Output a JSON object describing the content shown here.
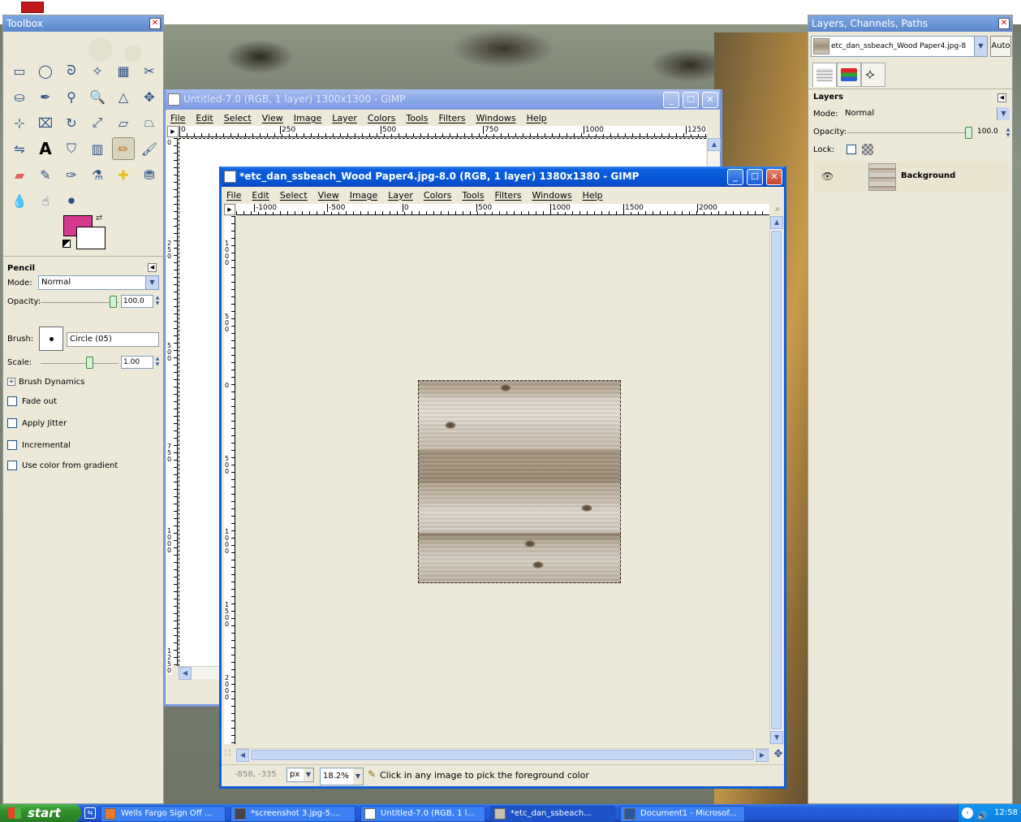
{
  "toolbox": {
    "title": "Toolbox",
    "tool_name": "Pencil",
    "mode_label": "Mode:",
    "mode_value": "Normal",
    "opacity_label": "Opacity:",
    "opacity_value": "100.0",
    "brush_label": "Brush:",
    "brush_value": "Circle (05)",
    "scale_label": "Scale:",
    "scale_value": "1.00",
    "brush_dynamics": "Brush Dynamics",
    "fade_out": "Fade out",
    "apply_jitter": "Apply Jitter",
    "incremental": "Incremental",
    "use_color_from_gradient": "Use color from gradient",
    "foreground_color": "#d63a90",
    "background_color": "#ffffff",
    "tools": [
      "rect-select-icon",
      "ellipse-select-icon",
      "free-select-icon",
      "fuzzy-select-icon",
      "select-by-color-icon",
      "scissors-icon",
      "foreground-select-icon",
      "paths-icon",
      "color-picker-icon",
      "zoom-icon",
      "measure-icon",
      "move-icon",
      "align-icon",
      "crop-icon",
      "rotate-icon",
      "scale-icon",
      "shear-icon",
      "perspective-icon",
      "flip-icon",
      "text-icon",
      "bucket-fill-icon",
      "blend-icon",
      "pencil-icon",
      "paintbrush-icon",
      "eraser-icon",
      "airbrush-icon",
      "ink-icon",
      "clone-icon",
      "heal-icon",
      "perspective-clone-icon",
      "blur-icon",
      "smudge-icon",
      "dodge-burn-icon"
    ]
  },
  "window_back": {
    "title": "Untitled-7.0 (RGB, 1 layer) 1300x1300 - GIMP",
    "ruler_labels": [
      "0",
      "250",
      "500",
      "750",
      "1000",
      "1250"
    ],
    "vruler_labels": [
      "0",
      "250",
      "500",
      "750",
      "1000",
      "1250"
    ]
  },
  "window_front": {
    "title": "*etc_dan_ssbeach_Wood Paper4.jpg-8.0 (RGB, 1 layer) 1380x1380 - GIMP",
    "ruler_labels": [
      "-1000",
      "-500",
      "0",
      "500",
      "1000",
      "1500",
      "2000"
    ],
    "vruler_labels": [
      "1000",
      "500",
      "0",
      "500",
      "1000",
      "1500",
      "2000"
    ],
    "coords": "-858, -335",
    "unit": "px",
    "zoom": "18.2%",
    "status": "Click in any image to pick the foreground color"
  },
  "menu": [
    "File",
    "Edit",
    "Select",
    "View",
    "Image",
    "Layer",
    "Colors",
    "Tools",
    "Filters",
    "Windows",
    "Help"
  ],
  "layers_dock": {
    "title": "Layers, Channels, Paths",
    "image_select": "etc_dan_ssbeach_Wood Paper4.jpg-8",
    "auto_button": "Auto",
    "section_title": "Layers",
    "mode_label": "Mode:",
    "mode_value": "Normal",
    "opacity_label": "Opacity:",
    "opacity_value": "100.0",
    "lock_label": "Lock:",
    "layer_name": "Background"
  },
  "taskbar": {
    "start": "start",
    "items": [
      "Wells Fargo Sign Off ...",
      "*screenshot 3.jpg-5....",
      "Untitled-7.0 (RGB, 1 l...",
      "*etc_dan_ssbeach...",
      "Document1 - Microsof..."
    ],
    "clock": "12:58"
  }
}
